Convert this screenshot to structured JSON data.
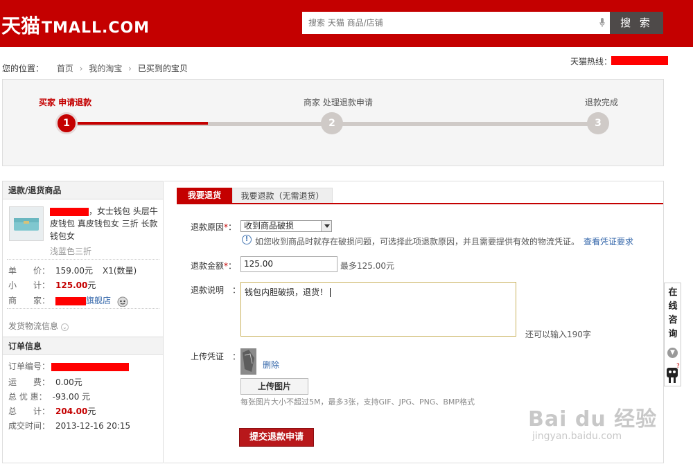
{
  "header": {
    "logo_cn": "天猫",
    "logo_en": "TMALL.COM",
    "search_placeholder": "搜索 天猫 商品/店铺",
    "search_button": "搜 索"
  },
  "breadcrumb": {
    "label": "您的位置：",
    "items": [
      "首页",
      "我的淘宝",
      "已买到的宝贝"
    ]
  },
  "hotline": {
    "label": "天猫热线："
  },
  "progress": {
    "steps": [
      {
        "label": "买家 申请退款",
        "number": "1"
      },
      {
        "label": "商家 处理退款申请",
        "number": "2"
      },
      {
        "label": "退款完成",
        "number": "3"
      }
    ],
    "current_step": 1
  },
  "left_panel": {
    "product_section_title": "退款/退货商品",
    "product_title_visible": "，女士钱包 头层牛皮钱包 真皮钱包女 三折 长款钱包女",
    "product_sku": "浅蓝色三折",
    "unit_price_label": "单　　价：",
    "unit_price": "159.00元",
    "quantity": "X1(数量)",
    "subtotal_label": "小　　计：",
    "subtotal": "125.00",
    "subtotal_unit": "元",
    "seller_label": "商　　家：",
    "seller_suffix": "旗舰店",
    "shipping_link": "发货物流信息",
    "order_section_title": "订单信息",
    "order_no_label": "订单编号：",
    "freight_label": "运　　费：",
    "freight": "0.00元",
    "discount_label": "总 优 惠：",
    "discount": "-93.00 元",
    "total_label": "总　　计：",
    "total": "204.00",
    "total_unit": "元",
    "deal_time_label": "成交时间：",
    "deal_time": "2013-12-16 20:15"
  },
  "right_panel": {
    "tabs": [
      "我要退货",
      "我要退款（无需退货）"
    ],
    "reason_label": "退款原因",
    "reason_value": "收到商品破损",
    "reason_hint": "如您收到商品时就存在破损问题，可选择此项退款原因，并且需要提供有效的物流凭证。",
    "reason_hint_link": "查看凭证要求",
    "amount_label": "退款金额",
    "amount_value": "125.00",
    "amount_max": "最多125.00元",
    "desc_label": "退款说明",
    "desc_value": "钱包内胆破损，退货！",
    "remaining": "还可以输入190字",
    "upload_label": "上传凭证",
    "delete_link": "删除",
    "upload_button": "上传图片",
    "upload_hint": "每张图片大小不超过5M，最多3张，支持GIF、JPG、PNG、BMP格式",
    "submit_button": "提交退款申请"
  },
  "consult": {
    "text": "在线咨询"
  },
  "watermark": {
    "logo": "Bai du 经验",
    "url": "jingyan.baidu.com"
  },
  "colors": {
    "brand": "#c40000",
    "progress_track": "#cfcac7",
    "link": "#3366aa"
  }
}
